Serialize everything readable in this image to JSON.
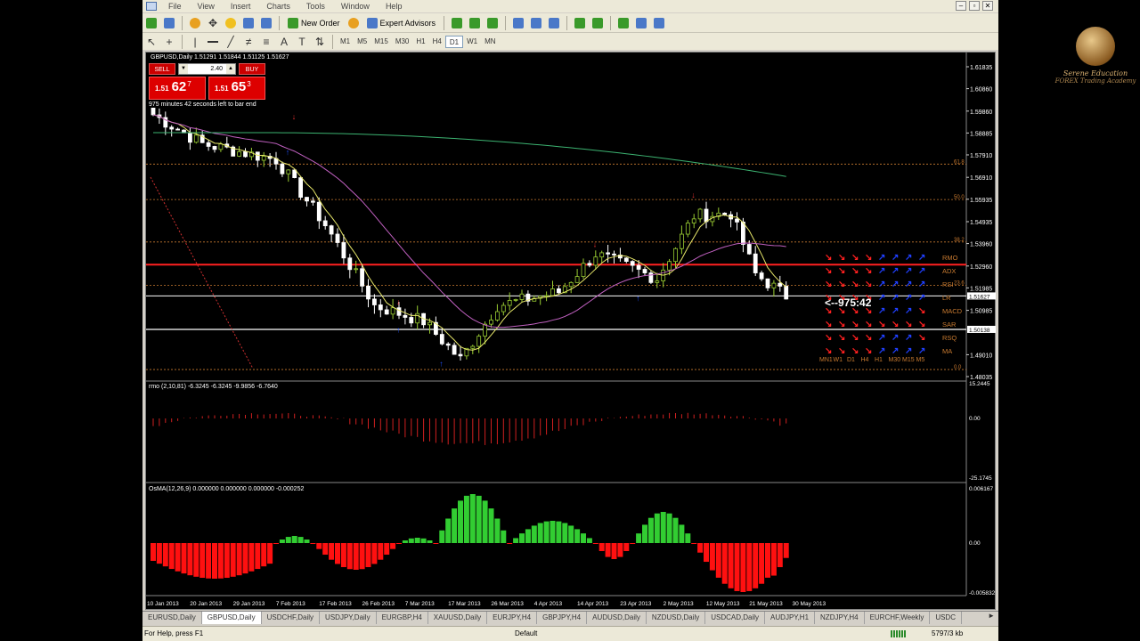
{
  "menu": [
    "File",
    "View",
    "Insert",
    "Charts",
    "Tools",
    "Window",
    "Help"
  ],
  "window_buttons": [
    "–",
    "▫",
    "✕"
  ],
  "toolbar": {
    "new_order": "New Order",
    "expert_advisors": "Expert Advisors"
  },
  "timeframes": [
    "M1",
    "M5",
    "M15",
    "M30",
    "H1",
    "H4",
    "D1",
    "W1",
    "MN"
  ],
  "active_timeframe": "D1",
  "chart": {
    "info": "GBPUSD,Daily  1.51291 1.51844 1.51125 1.51627",
    "sell_label": "SELL",
    "buy_label": "BUY",
    "lot": "2.40",
    "sell_price": {
      "small": "1.51",
      "big": "62",
      "sup": "7"
    },
    "buy_price": {
      "small": "1.51",
      "big": "65",
      "sup": "3"
    },
    "bar_timer": "975 minutes 42 seconds left to bar end",
    "countdown": "<--975:42",
    "price_labels": [
      "1.61835",
      "1.60860",
      "1.59860",
      "1.58885",
      "1.57910",
      "1.56910",
      "1.55935",
      "1.54935",
      "1.53960",
      "1.52960",
      "1.51985",
      "1.50985",
      "1.49010",
      "1.48035"
    ],
    "current_price_tag": "1.51627",
    "line_price_tag": "1.50138",
    "fib_labels": [
      "61.8",
      "50.0",
      "38.2",
      "23.6",
      "0.0"
    ],
    "signal_rows": [
      "RMO",
      "ADX",
      "RSI",
      "LR",
      "MACD",
      "SAR",
      "RSQ",
      "MA"
    ],
    "signal_columns": [
      "MN1",
      "W1",
      "D1",
      "H4",
      "H1",
      "M30",
      "M15",
      "M5"
    ],
    "date_labels": [
      "10 Jan 2013",
      "20 Jan 2013",
      "29 Jan 2013",
      "7 Feb 2013",
      "17 Feb 2013",
      "26 Feb 2013",
      "7 Mar 2013",
      "17 Mar 2013",
      "26 Mar 2013",
      "4 Apr 2013",
      "14 Apr 2013",
      "23 Apr 2013",
      "2 May 2013",
      "12 May 2013",
      "21 May 2013",
      "30 May 2013"
    ]
  },
  "rmo": {
    "label": "rmo (2,10,81) -6.3245 -6.3245 -9.9856 -6.7640",
    "axis": [
      "15.2445",
      "0.00",
      "-25.1745"
    ]
  },
  "osma": {
    "label": "OsMA(12,26,9) 0.000000 0.000000 0.000000 -0.000252",
    "axis": [
      "0.006167",
      "0.00",
      "-0.005832"
    ]
  },
  "tabs": [
    "EURUSD,Daily",
    "GBPUSD,Daily",
    "USDCHF,Daily",
    "USDJPY,Daily",
    "EURGBP,H4",
    "XAUUSD,Daily",
    "EURJPY,H4",
    "GBPJPY,H4",
    "AUDUSD,Daily",
    "NZDUSD,Daily",
    "USDCAD,Daily",
    "AUDJPY,H1",
    "NZDJPY,H4",
    "EURCHF,Weekly",
    "USDC"
  ],
  "active_tab": "GBPUSD,Daily",
  "status": {
    "help": "For Help, press F1",
    "profile": "Default",
    "traffic": "5797/3 kb"
  },
  "logo": {
    "name": "Serene Education",
    "sub": "FOREX Trading Academy"
  },
  "colors": {
    "bull_candle": "#9acd32",
    "bear_candle": "#ffffff",
    "ma_fast": "#e8e86a",
    "ma_mid": "#c060c0",
    "ma_slow": "#3cb371",
    "level_red": "#ff2020",
    "fib": "#c87a30",
    "osma_up": "#32cd32",
    "osma_down": "#ff1010",
    "rmo": "#d02020"
  }
}
